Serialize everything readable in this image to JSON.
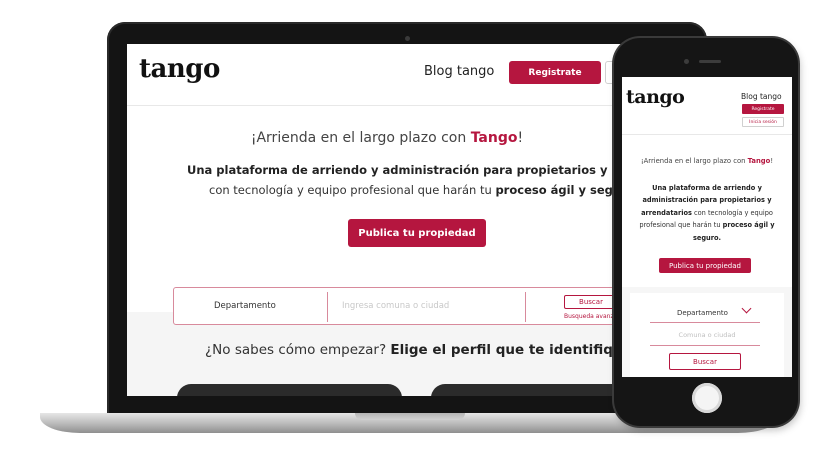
{
  "brand": {
    "logo_text": "tango",
    "accent_color": "#b5163f"
  },
  "desktop": {
    "header": {
      "blog_link": "Blog tango",
      "register_button": "Registrate"
    },
    "hero": {
      "headline_prefix": "¡Arrienda en el largo plazo con ",
      "headline_brand": "Tango",
      "headline_suffix": "!",
      "subtitle_line1": "Una plataforma de arriendo y administración para propietarios y arrendat",
      "subtitle_line2_prefix": "con tecnología y equipo profesional que harán tu ",
      "subtitle_line2_bold": "proceso ágil y seguro",
      "publish_button": "Publica tu propiedad"
    },
    "search": {
      "property_type": "Departamento",
      "location_placeholder": "Ingresa comuna o ciudad",
      "search_button": "Buscar",
      "advanced_link": "Busqueda avanza"
    },
    "profiles": {
      "question_prefix": "¿No sabes cómo empezar? ",
      "question_bold": "Elige el perfil que te identifiqu"
    }
  },
  "mobile": {
    "header": {
      "blog_link": "Blog tango",
      "register_button": "Registrate",
      "login_button": "Inicia sesión"
    },
    "hero": {
      "headline_prefix": "¡Arrienda en el largo plazo con ",
      "headline_brand": "Tango",
      "headline_suffix": "!",
      "desc_bold": "Una plataforma de arriendo y administración para propietarios y arrendatarios",
      "desc_mid": " con tecnología y equipo profesional que harán tu ",
      "desc_bold2": "proceso ágil y seguro.",
      "publish_button": "Publica tu propiedad"
    },
    "search": {
      "property_type": "Departamento",
      "location_placeholder": "Comuna o ciudad",
      "search_button": "Buscar"
    }
  }
}
